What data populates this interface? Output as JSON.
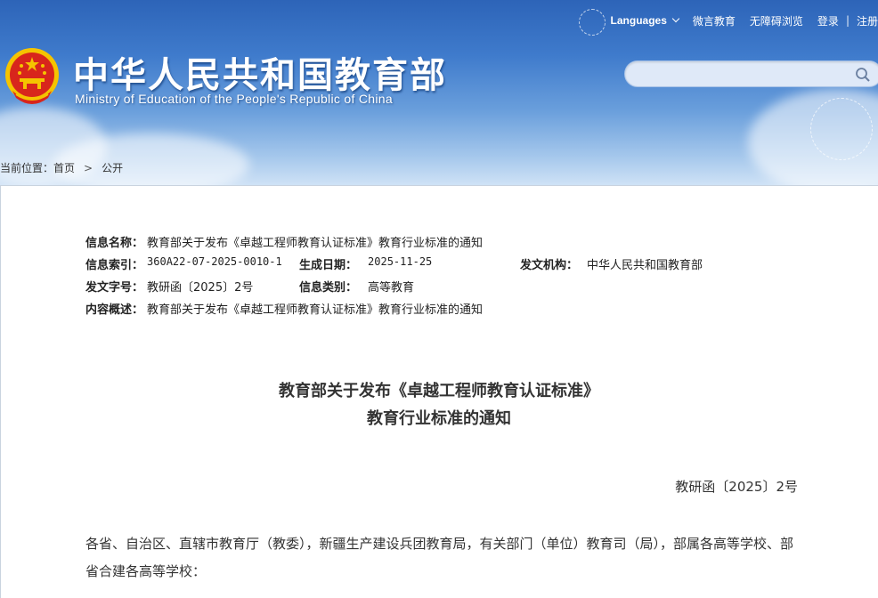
{
  "header": {
    "top_links": {
      "languages": "Languages",
      "weibo": "微言教育",
      "accessibility": "无障碍浏览",
      "login": "登录",
      "separator": "|",
      "register": "注册"
    },
    "title": "中华人民共和国教育部",
    "subtitle": "Ministry of Education of the People's Republic of China",
    "search": {
      "value": "",
      "placeholder": ""
    }
  },
  "breadcrumb": {
    "prefix": "当前位置：",
    "items": [
      "首页",
      "公开"
    ]
  },
  "meta": {
    "info_name_label": "信息名称：",
    "info_name": "教育部关于发布《卓越工程师教育认证标准》教育行业标准的通知",
    "index_label": "信息索引：",
    "index": "360A22-07-2025-0010-1",
    "date_label": "生成日期：",
    "date": "2025-11-25",
    "org_label": "发文机构：",
    "org": "中华人民共和国教育部",
    "doc_no_label": "发文字号：",
    "doc_no": "教研函〔2025〕2号",
    "category_label": "信息类别：",
    "category": "高等教育",
    "summary_label": "内容概述：",
    "summary": "教育部关于发布《卓越工程师教育认证标准》教育行业标准的通知"
  },
  "document": {
    "title_line1": "教育部关于发布《卓越工程师教育认证标准》",
    "title_line2": "教育行业标准的通知",
    "number": "教研函〔2025〕2号",
    "body": "各省、自治区、直辖市教育厅（教委），新疆生产建设兵团教育局，有关部门（单位）教育司（局），部属各高等学校、部省合建各高等学校："
  },
  "colors": {
    "header_top": "#2d64b8",
    "header_bottom": "#cfe2f6",
    "emblem_red": "#d8261c",
    "emblem_gold": "#f5c400"
  }
}
